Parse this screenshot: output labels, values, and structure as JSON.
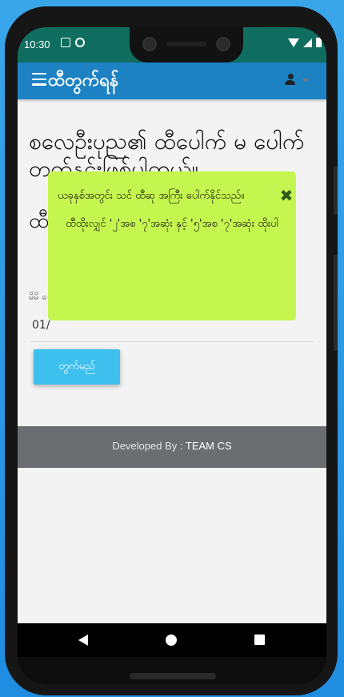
{
  "status_bar": {
    "time": "10:30"
  },
  "app_bar": {
    "title": "ထီတွက်ရန်"
  },
  "content": {
    "heading": "စလေဦးပုည၏ ထီပေါက် မ ပေါက် တက်နှင့်းဖြစ်ပါတယ်။",
    "heading_partial": "ထီ",
    "date_label": "မိမိ ေ",
    "date_value": "01/"
  },
  "modal": {
    "message": "ယခုနှစ်အတွင်း သင် ထီဆု အကြီး ပေါက်နိုင်သည်။",
    "detail": "ထီထိုးလျှင် '၂'အစ '၇'အဆုံး နှင့် '၅'အစ '၇'အဆုံး ထိုးပါ",
    "close_symbol": "✖"
  },
  "submit_label": "တွက်မည်",
  "footer": {
    "prefix": "Developed By :",
    "team": "TEAM CS"
  }
}
